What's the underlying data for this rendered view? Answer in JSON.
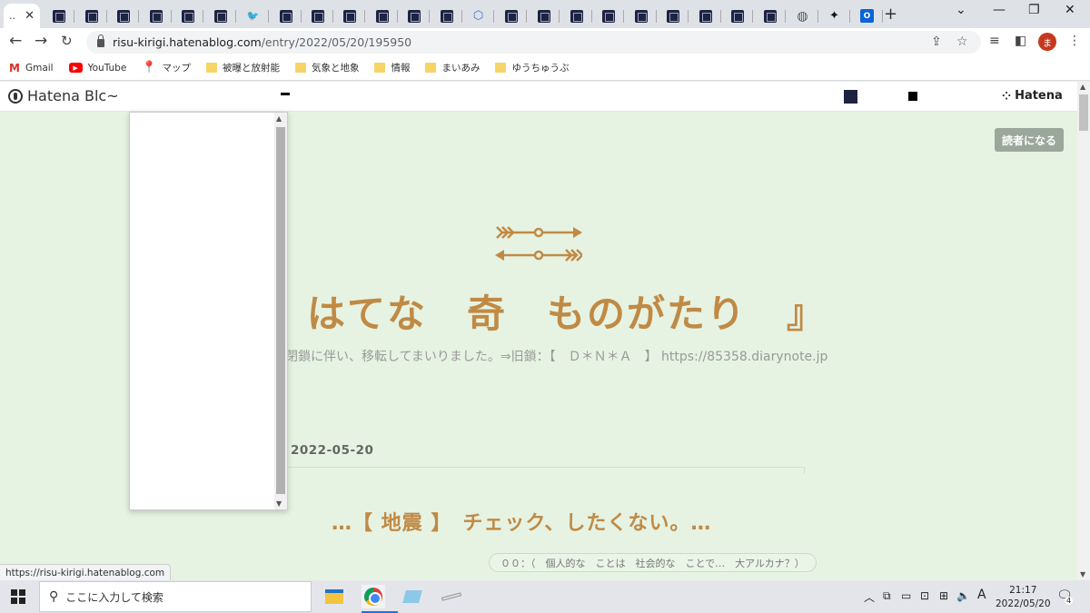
{
  "browser": {
    "active_tab": {
      "title": "..",
      "close": "✕"
    },
    "new_tab": "+",
    "window_controls": {
      "tablist": "⌄",
      "minimize": "—",
      "restore": "❐",
      "close": "✕"
    },
    "url_host": "risu-kirigi.hatenablog.com",
    "url_path": "/entry/2022/05/20/195950",
    "profile_initial": "ま"
  },
  "bookmarks": [
    {
      "label": "Gmail",
      "icon": "gmail-icon"
    },
    {
      "label": "YouTube",
      "icon": "youtube-icon"
    },
    {
      "label": "マップ",
      "icon": "maps-icon"
    },
    {
      "label": "被曝と放射能",
      "icon": "folder-icon"
    },
    {
      "label": "気象と地象",
      "icon": "folder-icon"
    },
    {
      "label": "情報",
      "icon": "folder-icon"
    },
    {
      "label": "まいあみ",
      "icon": "folder-icon"
    },
    {
      "label": "ゆうちゅうぶ",
      "icon": "folder-icon"
    }
  ],
  "hatena": {
    "logo_text": "Hatena Blc~",
    "brand": "Hatena",
    "follow_label": "読者になる"
  },
  "blog": {
    "title": "はてな　奇　ものがたり　』",
    "description": "閉鎖に伴い、移転してまいりました。⇒旧鎖：【　Ｄ＊Ｎ＊Ａ　】 https://85358.diarynote.jp",
    "date": "2022-05-20",
    "entry_title": "…【 地震 】　チェック、したくない。…",
    "tag": "００：（　個人的な　ことは　社会的な　ことで…　大アルカナ？）"
  },
  "status_url": "https://risu-kirigi.hatenablog.com",
  "taskbar": {
    "search_placeholder": "ここに入力して検索",
    "ime": "A",
    "time": "21:17",
    "date": "2022/05/20",
    "notification_count": "4"
  },
  "colors": {
    "accent": "#c08a45",
    "page_bg": "#e6f3e2",
    "follow_bg": "#9aa79a"
  }
}
